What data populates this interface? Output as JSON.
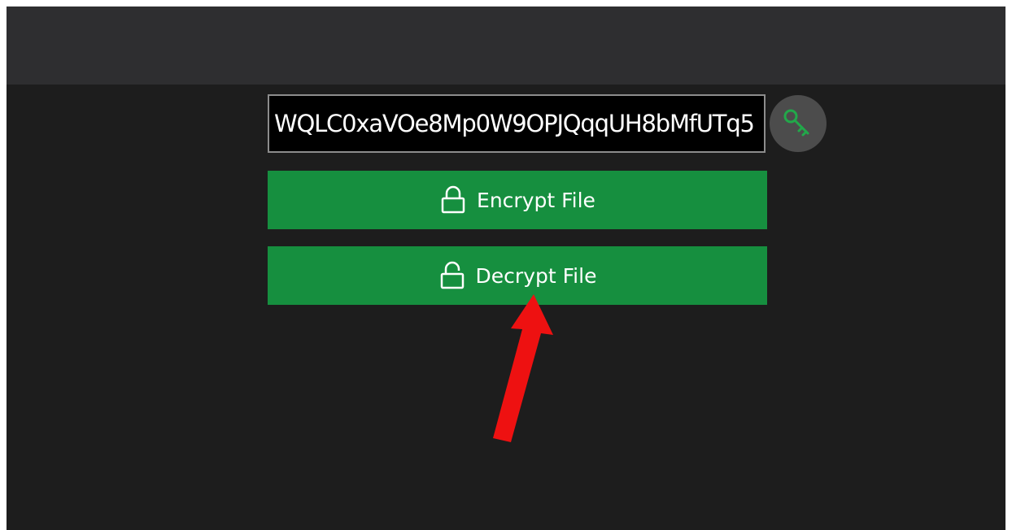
{
  "key_field": {
    "value": "WQLC0xaVOe8Mp0W9OPJQqqUH8bMfUTq5"
  },
  "key_button": {
    "icon": "key-icon"
  },
  "buttons": {
    "encrypt": {
      "label": "Encrypt File",
      "icon": "lock-icon"
    },
    "decrypt": {
      "label": "Decrypt File",
      "icon": "unlock-icon"
    }
  },
  "colors": {
    "background": "#1d1d1d",
    "titlebar": "#2e2e30",
    "button_green": "#168f3f",
    "key_green": "#22a84a",
    "arrow_red": "#ee1111"
  }
}
